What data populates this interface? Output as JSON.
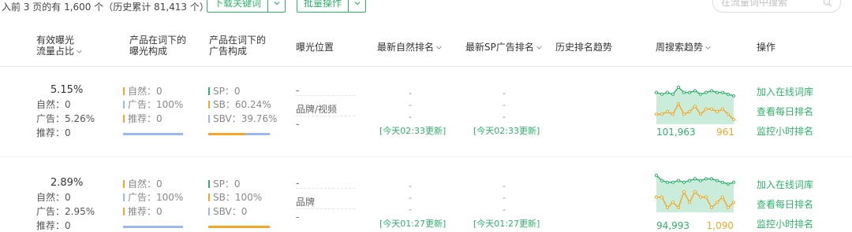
{
  "toolbar": {
    "summary": "入前 3 页的有 1,600 个（历史累计 81,413 个）",
    "download_label": "下载关键词",
    "batch_label": "批量操作",
    "search_placeholder": "在流量词中搜索",
    "accent": "#2db36a"
  },
  "columns": [
    {
      "line1": "有效曝光",
      "line2": "流量占比"
    },
    {
      "line1": "产品在词下的",
      "line2": "曝光构成"
    },
    {
      "line1": "产品在词下的",
      "line2": "广告构成"
    },
    {
      "line1": "曝光位置",
      "line2": ""
    },
    {
      "line1": "最新自然排名",
      "line2": ""
    },
    {
      "line1": "最新SP广告排名",
      "line2": ""
    },
    {
      "line1": "历史排名趋势",
      "line2": ""
    },
    {
      "line1": "周搜索趋势",
      "line2": ""
    },
    {
      "line1": "操作",
      "line2": ""
    }
  ],
  "rows": [
    {
      "share_pct": "5.15%",
      "share_natural": "自然：0",
      "share_ad": "广告：5.26%",
      "share_rec": "推荐：0",
      "exp_natural": "自然：0",
      "exp_ad": "广告：100%",
      "exp_rec": "推荐：0",
      "exp_bar": {
        "natural": 0,
        "ad": 1.0,
        "rec": 0
      },
      "ad_sp": "SP：0",
      "ad_sb": "SB：60.24%",
      "ad_sbv": "SBV：39.76%",
      "ad_bar": {
        "sp": 0,
        "sb": 0.6024,
        "sbv": 0.3976
      },
      "pos_1": "-",
      "pos_2": "品牌/视频",
      "pos_3": "-",
      "natural_rank": "-",
      "natural_rank_2": "-",
      "natural_rank_3": "-",
      "natural_update": "[今天02:33更新]",
      "sp_rank": "-",
      "sp_rank_2": "-",
      "sp_rank_3": "-",
      "sp_update": "[今天02:33更新]",
      "search_volume": "101,963",
      "search_rank": "961",
      "trend_green": [
        5,
        4,
        5,
        4,
        8,
        5,
        5,
        6,
        4,
        5,
        6,
        5,
        5,
        4,
        3
      ],
      "trend_orange": [
        5,
        5,
        6,
        5,
        9,
        5,
        6,
        8,
        5,
        7,
        7,
        6,
        7,
        5,
        3
      ],
      "actions": [
        "加入在线词库",
        "查看每日排名",
        "监控小时排名"
      ]
    },
    {
      "share_pct": "2.89%",
      "share_natural": "自然：0",
      "share_ad": "广告：2.95%",
      "share_rec": "推荐：0",
      "exp_natural": "自然：0",
      "exp_ad": "广告：100%",
      "exp_rec": "推荐：0",
      "exp_bar": {
        "natural": 0,
        "ad": 1.0,
        "rec": 0
      },
      "ad_sp": "SP：0",
      "ad_sb": "SB：100%",
      "ad_sbv": "SBV：0",
      "ad_bar": {
        "sp": 0,
        "sb": 1.0,
        "sbv": 0
      },
      "pos_1": "-",
      "pos_2": "品牌",
      "pos_3": "-",
      "natural_rank": "-",
      "natural_rank_2": "-",
      "natural_rank_3": "-",
      "natural_update": "[今天01:27更新]",
      "sp_rank": "-",
      "sp_rank_2": "-",
      "sp_rank_3": "-",
      "sp_update": "[今天01:27更新]",
      "search_volume": "94,993",
      "search_rank": "1,090",
      "trend_green": [
        9,
        6,
        5,
        5,
        6,
        5,
        6,
        7,
        6,
        7,
        7,
        6,
        5,
        4,
        5
      ],
      "trend_orange": [
        7,
        7,
        5,
        6,
        5,
        8,
        6,
        8,
        7,
        7,
        5,
        6,
        7,
        5,
        6
      ],
      "actions": [
        "加入在线词库",
        "查看每日排名",
        "监控小时排名"
      ]
    }
  ],
  "colors": {
    "green": "#2db36a",
    "orange": "#f5a623",
    "blue": "#9bb8f0"
  }
}
